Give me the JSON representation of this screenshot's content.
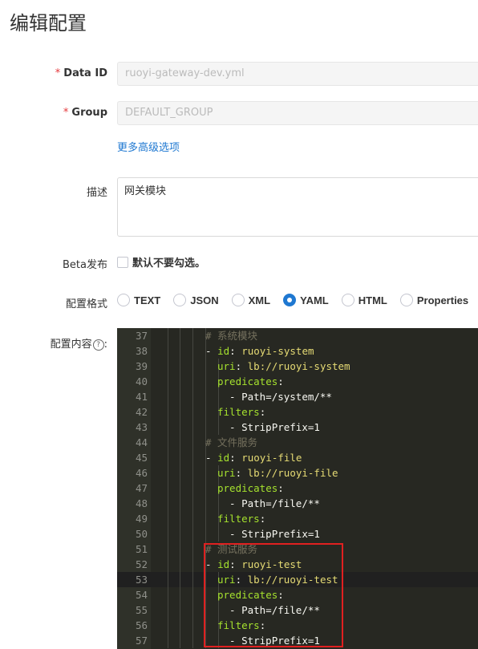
{
  "page": {
    "title": "编辑配置"
  },
  "form": {
    "data_id": {
      "label": "Data ID",
      "required_mark": "*",
      "placeholder": "ruoyi-gateway-dev.yml"
    },
    "group": {
      "label": "Group",
      "required_mark": "*",
      "placeholder": "DEFAULT_GROUP"
    },
    "advanced_link": "更多高级选项",
    "description": {
      "label": "描述",
      "value": "网关模块"
    },
    "beta": {
      "label": "Beta发布",
      "checkbox_label": "默认不要勾选。",
      "checked": false
    },
    "format": {
      "label": "配置格式",
      "options": [
        "TEXT",
        "JSON",
        "XML",
        "YAML",
        "HTML",
        "Properties"
      ],
      "selected": "YAML"
    },
    "content": {
      "label": "配置内容",
      "suffix": ":"
    }
  },
  "editor": {
    "lines": [
      {
        "n": "37",
        "indent": 1,
        "comment": "# 系统模块"
      },
      {
        "n": "38",
        "indent": 1,
        "dash": true,
        "key": "id",
        "value": "ruoyi-system"
      },
      {
        "n": "39",
        "indent": 2,
        "key": "uri",
        "value": "lb://ruoyi-system"
      },
      {
        "n": "40",
        "indent": 2,
        "key": "predicates"
      },
      {
        "n": "41",
        "indent": 3,
        "dash": true,
        "value": "Path=/system/**"
      },
      {
        "n": "42",
        "indent": 2,
        "key": "filters"
      },
      {
        "n": "43",
        "indent": 3,
        "dash": true,
        "value": "StripPrefix=1"
      },
      {
        "n": "44",
        "indent": 1,
        "comment": "# 文件服务"
      },
      {
        "n": "45",
        "indent": 1,
        "dash": true,
        "key": "id",
        "value": "ruoyi-file"
      },
      {
        "n": "46",
        "indent": 2,
        "key": "uri",
        "value": "lb://ruoyi-file"
      },
      {
        "n": "47",
        "indent": 2,
        "key": "predicates"
      },
      {
        "n": "48",
        "indent": 3,
        "dash": true,
        "value": "Path=/file/**"
      },
      {
        "n": "49",
        "indent": 2,
        "key": "filters"
      },
      {
        "n": "50",
        "indent": 3,
        "dash": true,
        "value": "StripPrefix=1"
      },
      {
        "n": "51",
        "indent": 1,
        "comment": "# 测试服务"
      },
      {
        "n": "52",
        "indent": 1,
        "dash": true,
        "key": "id",
        "value": "ruoyi-test"
      },
      {
        "n": "53",
        "indent": 2,
        "key": "uri",
        "value": "lb://ruoyi-test",
        "active": true
      },
      {
        "n": "54",
        "indent": 2,
        "key": "predicates"
      },
      {
        "n": "55",
        "indent": 3,
        "dash": true,
        "value": "Path=/file/**"
      },
      {
        "n": "56",
        "indent": 2,
        "key": "filters"
      },
      {
        "n": "57",
        "indent": 3,
        "dash": true,
        "value": "StripPrefix=1"
      }
    ]
  },
  "colors": {
    "accent": "#1f78d1",
    "required": "#e4393c",
    "highlight": "#e02020",
    "editor_bg": "#272822"
  }
}
